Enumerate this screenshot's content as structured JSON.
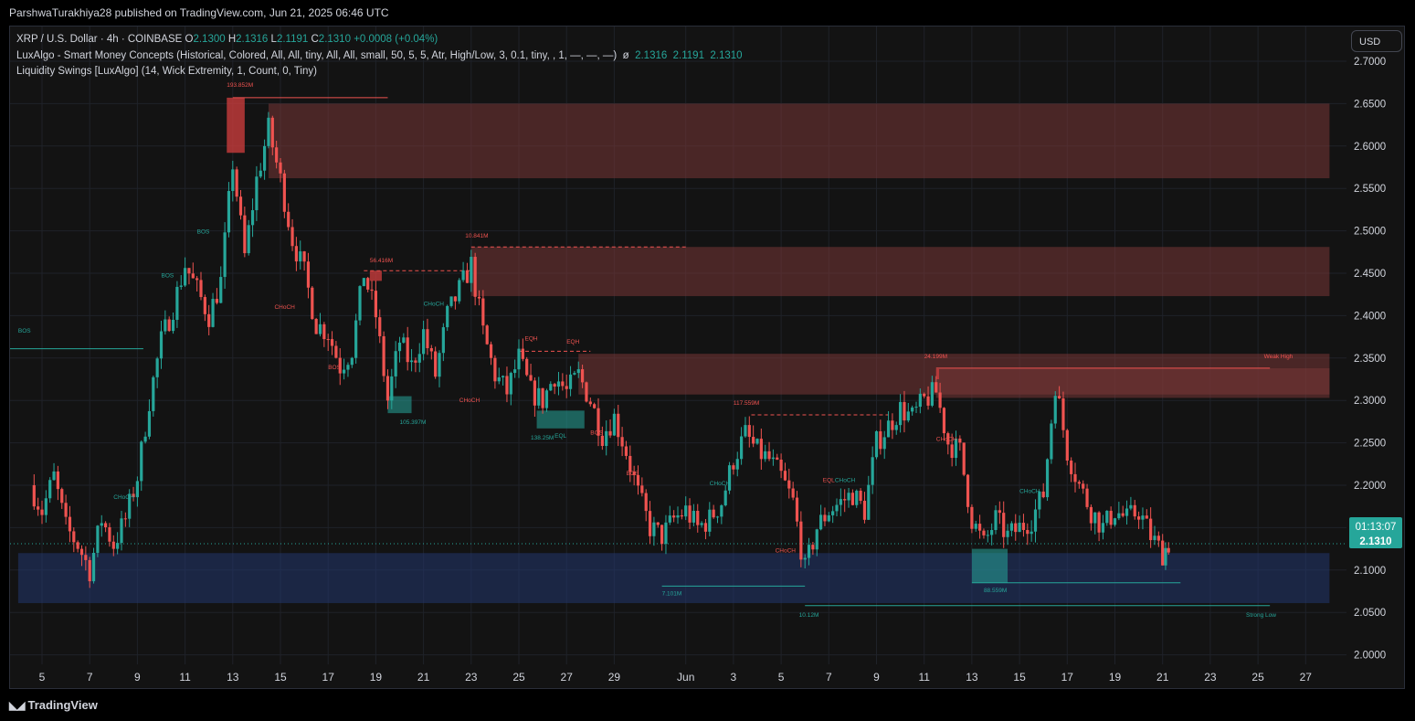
{
  "publish_line": "ParshwaTurakhiya28 published on TradingView.com, Jun 21, 2025 06:46 UTC",
  "currency_button": "USD",
  "brand": "TradingView",
  "legend": {
    "symbol": "XRP / U.S. Dollar · 4h · COINBASE",
    "o_label": "O",
    "o_value": "2.1300",
    "h_label": "H",
    "h_value": "2.1316",
    "l_label": "L",
    "l_value": "2.1191",
    "c_label": "C",
    "c_value": "2.1310",
    "change": "+0.0008 (+0.04%)",
    "indicator1": "LuxAlgo - Smart Money Concepts (Historical, Colored, All, All, tiny, All, All, small, 50, 5, 5, Atr, High/Low, 3, 0.1, tiny, , 1, —, —, —)",
    "indicator1_symbol": "ø",
    "indicator1_values": [
      "2.1316",
      "2.1191",
      "2.1310"
    ],
    "indicator2": "Liquidity Swings [LuxAlgo] (14, Wick Extremity, 1, Count, 0, Tiny)"
  },
  "chart_data": {
    "type": "candlestick",
    "series_colors": {
      "up": "#26a69a",
      "down": "#ef5350"
    },
    "ylim": [
      2.0,
      2.7
    ],
    "y_ticks": [
      "2.7000",
      "2.6500",
      "2.6000",
      "2.5500",
      "2.5000",
      "2.4500",
      "2.4000",
      "2.3500",
      "2.3000",
      "2.2500",
      "2.2000",
      "2.1500",
      "2.1000",
      "2.0500",
      "2.0000"
    ],
    "x_ticks": [
      "5",
      "7",
      "9",
      "11",
      "13",
      "15",
      "17",
      "19",
      "21",
      "23",
      "25",
      "27",
      "29",
      "Jun",
      "3",
      "5",
      "7",
      "9",
      "11",
      "13",
      "15",
      "17",
      "19",
      "21",
      "23",
      "25",
      "27"
    ],
    "x_tick_dates": [
      "2025-05-05",
      "2025-05-07",
      "2025-05-09",
      "2025-05-11",
      "2025-05-13",
      "2025-05-15",
      "2025-05-17",
      "2025-05-19",
      "2025-05-21",
      "2025-05-23",
      "2025-05-25",
      "2025-05-27",
      "2025-05-29",
      "2025-06-01",
      "2025-06-03",
      "2025-06-05",
      "2025-06-07",
      "2025-06-09",
      "2025-06-11",
      "2025-06-13",
      "2025-06-15",
      "2025-06-17",
      "2025-06-19",
      "2025-06-21",
      "2025-06-23",
      "2025-06-25",
      "2025-06-27"
    ],
    "price_marker": {
      "countdown": "01:13:07",
      "price": "2.1310",
      "value": 2.131
    },
    "close_path": [
      [
        "2025-05-04T12:00",
        2.2
      ],
      [
        "2025-05-05T00:00",
        2.17
      ],
      [
        "2025-05-05T12:00",
        2.21
      ],
      [
        "2025-05-06T00:00",
        2.15
      ],
      [
        "2025-05-06T12:00",
        2.13
      ],
      [
        "2025-05-07T00:00",
        2.1
      ],
      [
        "2025-05-07T12:00",
        2.16
      ],
      [
        "2025-05-08T00:00",
        2.13
      ],
      [
        "2025-05-08T12:00",
        2.16
      ],
      [
        "2025-05-09T00:00",
        2.21
      ],
      [
        "2025-05-09T12:00",
        2.3
      ],
      [
        "2025-05-10T00:00",
        2.37
      ],
      [
        "2025-05-10T12:00",
        2.41
      ],
      [
        "2025-05-11T00:00",
        2.46
      ],
      [
        "2025-05-11T12:00",
        2.43
      ],
      [
        "2025-05-12T00:00",
        2.4
      ],
      [
        "2025-05-12T12:00",
        2.44
      ],
      [
        "2025-05-13T00:00",
        2.58
      ],
      [
        "2025-05-13T12:00",
        2.47
      ],
      [
        "2025-05-14T00:00",
        2.56
      ],
      [
        "2025-05-14T12:00",
        2.62
      ],
      [
        "2025-05-15T00:00",
        2.56
      ],
      [
        "2025-05-15T12:00",
        2.49
      ],
      [
        "2025-05-16T00:00",
        2.45
      ],
      [
        "2025-05-16T12:00",
        2.39
      ],
      [
        "2025-05-17T00:00",
        2.38
      ],
      [
        "2025-05-17T12:00",
        2.34
      ],
      [
        "2025-05-18T00:00",
        2.36
      ],
      [
        "2025-05-18T12:00",
        2.45
      ],
      [
        "2025-05-19T00:00",
        2.4
      ],
      [
        "2025-05-19T12:00",
        2.3
      ],
      [
        "2025-05-20T00:00",
        2.37
      ],
      [
        "2025-05-20T12:00",
        2.34
      ],
      [
        "2025-05-21T00:00",
        2.38
      ],
      [
        "2025-05-21T12:00",
        2.33
      ],
      [
        "2025-05-22T00:00",
        2.4
      ],
      [
        "2025-05-22T12:00",
        2.43
      ],
      [
        "2025-05-23T00:00",
        2.46
      ],
      [
        "2025-05-23T12:00",
        2.38
      ],
      [
        "2025-05-24T00:00",
        2.33
      ],
      [
        "2025-05-24T12:00",
        2.31
      ],
      [
        "2025-05-25T00:00",
        2.35
      ],
      [
        "2025-05-25T12:00",
        2.31
      ],
      [
        "2025-05-26T00:00",
        2.3
      ],
      [
        "2025-05-26T12:00",
        2.33
      ],
      [
        "2025-05-27T00:00",
        2.31
      ],
      [
        "2025-05-27T12:00",
        2.33
      ],
      [
        "2025-05-28T00:00",
        2.3
      ],
      [
        "2025-05-28T12:00",
        2.26
      ],
      [
        "2025-05-29T00:00",
        2.28
      ],
      [
        "2025-05-29T12:00",
        2.24
      ],
      [
        "2025-05-30T00:00",
        2.19
      ],
      [
        "2025-05-30T12:00",
        2.15
      ],
      [
        "2025-05-31T00:00",
        2.14
      ],
      [
        "2025-05-31T12:00",
        2.16
      ],
      [
        "2025-06-01T00:00",
        2.17
      ],
      [
        "2025-06-01T12:00",
        2.15
      ],
      [
        "2025-06-02T00:00",
        2.16
      ],
      [
        "2025-06-02T12:00",
        2.18
      ],
      [
        "2025-06-03T00:00",
        2.23
      ],
      [
        "2025-06-03T12:00",
        2.26
      ],
      [
        "2025-06-04T00:00",
        2.24
      ],
      [
        "2025-06-04T12:00",
        2.23
      ],
      [
        "2025-06-05T00:00",
        2.21
      ],
      [
        "2025-06-05T12:00",
        2.18
      ],
      [
        "2025-06-06T00:00",
        2.1
      ],
      [
        "2025-06-06T12:00",
        2.15
      ],
      [
        "2025-06-07T00:00",
        2.17
      ],
      [
        "2025-06-07T12:00",
        2.18
      ],
      [
        "2025-06-08T00:00",
        2.19
      ],
      [
        "2025-06-08T12:00",
        2.17
      ],
      [
        "2025-06-09T00:00",
        2.25
      ],
      [
        "2025-06-09T12:00",
        2.27
      ],
      [
        "2025-06-10T00:00",
        2.29
      ],
      [
        "2025-06-10T12:00",
        2.28
      ],
      [
        "2025-06-11T00:00",
        2.3
      ],
      [
        "2025-06-11T12:00",
        2.31
      ],
      [
        "2025-06-12T00:00",
        2.25
      ],
      [
        "2025-06-12T12:00",
        2.24
      ],
      [
        "2025-06-13T00:00",
        2.16
      ],
      [
        "2025-06-13T12:00",
        2.13
      ],
      [
        "2025-06-14T00:00",
        2.16
      ],
      [
        "2025-06-14T12:00",
        2.14
      ],
      [
        "2025-06-15T00:00",
        2.15
      ],
      [
        "2025-06-15T12:00",
        2.16
      ],
      [
        "2025-06-16T00:00",
        2.19
      ],
      [
        "2025-06-16T12:00",
        2.32
      ],
      [
        "2025-06-17T00:00",
        2.24
      ],
      [
        "2025-06-17T12:00",
        2.2
      ],
      [
        "2025-06-18T00:00",
        2.17
      ],
      [
        "2025-06-18T12:00",
        2.15
      ],
      [
        "2025-06-19T00:00",
        2.17
      ],
      [
        "2025-06-19T12:00",
        2.16
      ],
      [
        "2025-06-20T00:00",
        2.17
      ],
      [
        "2025-06-20T12:00",
        2.14
      ],
      [
        "2025-06-21T00:00",
        2.12
      ],
      [
        "2025-06-21T06:00",
        2.131
      ]
    ],
    "zones": [
      {
        "kind": "supply",
        "from": "2025-05-14T12:00",
        "to": "2025-06-28",
        "low": 2.562,
        "high": 2.65
      },
      {
        "kind": "supply",
        "from": "2025-05-23T00:00",
        "to": "2025-06-28",
        "low": 2.423,
        "high": 2.481
      },
      {
        "kind": "supply",
        "from": "2025-05-27T12:00",
        "to": "2025-06-28",
        "low": 2.307,
        "high": 2.355
      },
      {
        "kind": "supply",
        "from": "2025-06-11T12:00",
        "to": "2025-06-28",
        "low": 2.303,
        "high": 2.338
      },
      {
        "kind": "demand",
        "from": "2025-05-04",
        "to": "2025-06-28",
        "low": 2.061,
        "high": 2.12
      }
    ],
    "order_blocks": [
      {
        "kind": "bear",
        "from": "2025-05-12T18:00",
        "to": "2025-05-13T12:00",
        "low": 2.592,
        "high": 2.657
      },
      {
        "kind": "bear",
        "from": "2025-05-18T18:00",
        "to": "2025-05-19T06:00",
        "low": 2.441,
        "high": 2.453
      },
      {
        "kind": "bear",
        "from": "2025-06-11T12:00",
        "to": "2025-06-11T15:00",
        "low": 2.325,
        "high": 2.337
      },
      {
        "kind": "bull",
        "from": "2025-05-19T12:00",
        "to": "2025-05-20T12:00",
        "low": 2.285,
        "high": 2.305
      },
      {
        "kind": "bull",
        "from": "2025-05-25T18:00",
        "to": "2025-05-27T18:00",
        "low": 2.267,
        "high": 2.288
      },
      {
        "kind": "bull",
        "from": "2025-06-13T00:00",
        "to": "2025-06-14T12:00",
        "low": 2.085,
        "high": 2.125
      }
    ],
    "annotations": [
      {
        "text": "193.852M",
        "x": "2025-05-12T18:00",
        "y": 2.67,
        "color": "#ef5350"
      },
      {
        "text": "56.416M",
        "x": "2025-05-18T18:00",
        "y": 2.463,
        "color": "#ef5350"
      },
      {
        "text": "10.841M",
        "x": "2025-05-22T18:00",
        "y": 2.492,
        "color": "#ef5350"
      },
      {
        "text": "117.559M",
        "x": "2025-06-03T00:00",
        "y": 2.295,
        "color": "#ef5350"
      },
      {
        "text": "24.199M",
        "x": "2025-06-11T00:00",
        "y": 2.35,
        "color": "#ef5350"
      },
      {
        "text": "Weak High",
        "x": "2025-06-25T06:00",
        "y": 2.35,
        "color": "#ef5350"
      },
      {
        "text": "EQH",
        "x": "2025-05-25T06:00",
        "y": 2.371,
        "color": "#ef5350"
      },
      {
        "text": "EQH",
        "x": "2025-05-27T00:00",
        "y": 2.367,
        "color": "#ef5350"
      },
      {
        "text": "CHoCH",
        "x": "2025-05-14T18:00",
        "y": 2.408,
        "color": "#ef5350"
      },
      {
        "text": "BOS",
        "x": "2025-05-17T00:00",
        "y": 2.337,
        "color": "#ef5350"
      },
      {
        "text": "CHoCH",
        "x": "2025-05-22T12:00",
        "y": 2.298,
        "color": "#ef5350"
      },
      {
        "text": "BOS",
        "x": "2025-05-28T00:00",
        "y": 2.26,
        "color": "#ef5350"
      },
      {
        "text": "BOS",
        "x": "2025-05-29T12:00",
        "y": 2.212,
        "color": "#ef5350"
      },
      {
        "text": "CHoCH",
        "x": "2025-06-04T18:00",
        "y": 2.121,
        "color": "#ef5350"
      },
      {
        "text": "CHoCH",
        "x": "2025-06-11T12:00",
        "y": 2.252,
        "color": "#ef5350"
      },
      {
        "text": "EQL",
        "x": "2025-06-06T18:00",
        "y": 2.204,
        "color": "#ef5350"
      },
      {
        "text": "BOS",
        "x": "2025-05-10T00:00",
        "y": 2.445,
        "color": "#26a69a"
      },
      {
        "text": "BOS",
        "x": "2025-05-11T12:00",
        "y": 2.497,
        "color": "#26a69a"
      },
      {
        "text": "CHoCH",
        "x": "2025-05-08T00:00",
        "y": 2.184,
        "color": "#26a69a"
      },
      {
        "text": "BOS",
        "x": "2025-05-04T00:00",
        "y": 2.38,
        "color": "#26a69a"
      },
      {
        "text": "CHoCH",
        "x": "2025-05-21T00:00",
        "y": 2.412,
        "color": "#26a69a"
      },
      {
        "text": "105.397M",
        "x": "2025-05-20T00:00",
        "y": 2.272,
        "color": "#26a69a"
      },
      {
        "text": "138.25M",
        "x": "2025-05-25T12:00",
        "y": 2.254,
        "color": "#26a69a"
      },
      {
        "text": "EQL",
        "x": "2025-05-26T12:00",
        "y": 2.256,
        "color": "#26a69a"
      },
      {
        "text": "CHoCH",
        "x": "2025-06-02T00:00",
        "y": 2.2,
        "color": "#26a69a"
      },
      {
        "text": "CHoCH",
        "x": "2025-06-07T06:00",
        "y": 2.204,
        "color": "#26a69a"
      },
      {
        "text": "CHoCH",
        "x": "2025-06-15T00:00",
        "y": 2.191,
        "color": "#26a69a"
      },
      {
        "text": "7.101M",
        "x": "2025-05-31T00:00",
        "y": 2.07,
        "color": "#26a69a"
      },
      {
        "text": "10.12M",
        "x": "2025-06-05T18:00",
        "y": 2.045,
        "color": "#26a69a"
      },
      {
        "text": "88.559M",
        "x": "2025-06-13T12:00",
        "y": 2.074,
        "color": "#26a69a"
      },
      {
        "text": "Strong Low",
        "x": "2025-06-24T12:00",
        "y": 2.045,
        "color": "#26a69a"
      }
    ]
  }
}
